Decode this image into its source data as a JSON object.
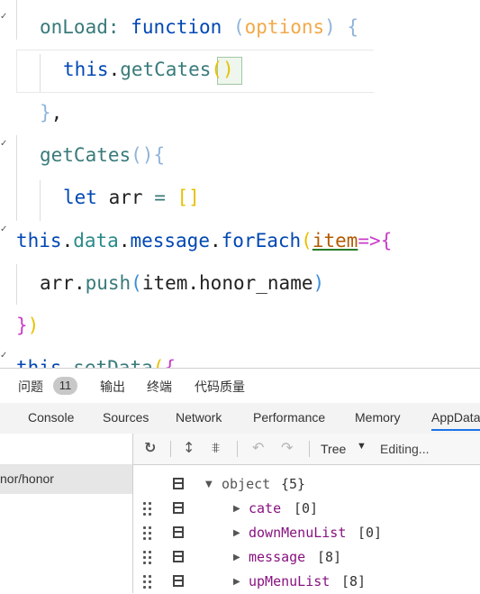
{
  "editor": {
    "line1": {
      "key": "onLoad",
      "colon": ":",
      "kw": "function",
      "paren_open": "(",
      "param": "options",
      "paren_close": ")",
      "brace": "{"
    },
    "line2": {
      "obj": "this",
      "dot": ".",
      "method": "getCates",
      "open": "(",
      "close": ")"
    },
    "line3": {
      "brace": "}",
      "comma": ","
    },
    "line4": {
      "name": "getCates",
      "parens": "()",
      "brace": "{"
    },
    "line5": {
      "kw": "let",
      "var": "arr",
      "eq": "=",
      "arr": "[]"
    },
    "line6": {
      "obj": "this",
      "d1": ".",
      "p1": "data",
      "d2": ".",
      "p2": "message",
      "d3": ".",
      "m": "forEach",
      "open": "(",
      "arg": "item",
      "arrow": "=>",
      "brace": "{"
    },
    "line7": {
      "obj": "arr",
      "dot": ".",
      "m": "push",
      "open": "(",
      "arg": "item.honor_name",
      "close": ")"
    },
    "line8": {
      "brace": "}",
      "paren": ")"
    },
    "line9": {
      "obj": "this",
      "dot": ".",
      "m": "setData",
      "open": "(",
      "brace": "{"
    }
  },
  "panel": {
    "top_tabs": [
      {
        "label": "问题"
      },
      {
        "label": "输出"
      },
      {
        "label": "终端"
      },
      {
        "label": "代码质量"
      }
    ],
    "problems_count": "11",
    "devtools_tabs": [
      "Console",
      "Sources",
      "Network",
      "Performance",
      "Memory",
      "AppData"
    ],
    "active_tab": "AppData",
    "sidebar_item": "nor/honor",
    "toolbar": {
      "refresh_icon": "refresh-icon",
      "expand_icon": "expand-all-icon",
      "collapse_icon": "collapse-all-icon",
      "undo_icon": "undo-icon",
      "redo_icon": "redo-icon",
      "view_mode": "Tree",
      "status": "Editing..."
    },
    "tree": [
      {
        "name": "object",
        "meta": "{5}",
        "expanded": true
      },
      {
        "name": "cate",
        "meta": "[0]"
      },
      {
        "name": "downMenuList",
        "meta": "[0]"
      },
      {
        "name": "message",
        "meta": "[8]"
      },
      {
        "name": "upMenuList",
        "meta": "[8]"
      }
    ]
  }
}
